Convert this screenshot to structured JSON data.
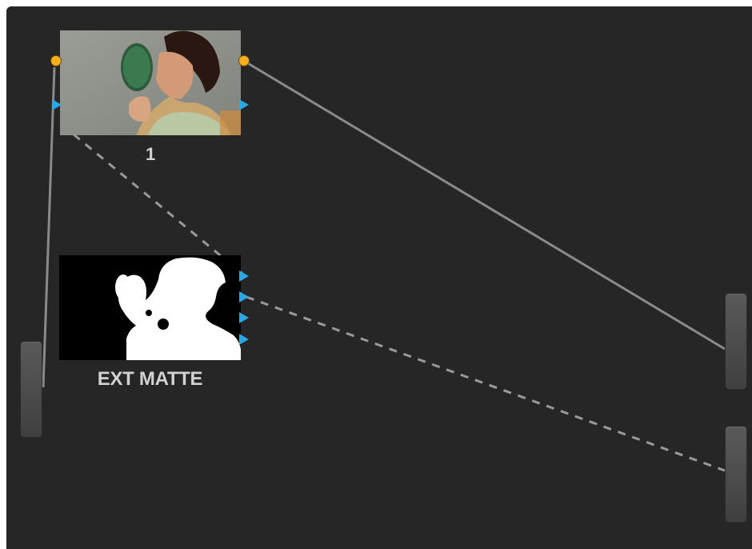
{
  "node_graph": {
    "nodes": [
      {
        "label": "1",
        "thumbnail": "woman-holding-mirror"
      },
      {
        "label": "EXT MATTE",
        "thumbnail": "white-matte-silhouette"
      }
    ],
    "input_handle_label": "",
    "output_handles": [
      "",
      ""
    ]
  },
  "colors": {
    "canvas": "#262626",
    "key_port": "#f4b01d",
    "rgb_port": "#2aa7e6",
    "wire": "#8a8a8a"
  }
}
